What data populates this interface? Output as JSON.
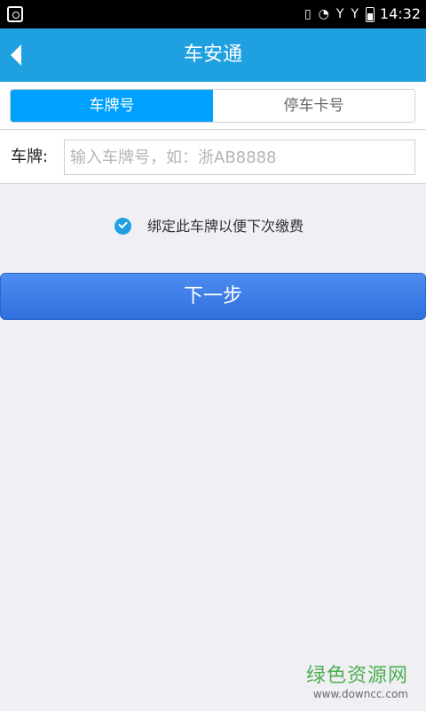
{
  "status_bar": {
    "time": "14:32",
    "indicator_1": "Y",
    "indicator_2": "Y"
  },
  "header": {
    "title": "车安通"
  },
  "tabs": [
    {
      "label": "车牌号",
      "active": true
    },
    {
      "label": "停车卡号",
      "active": false
    }
  ],
  "plate": {
    "label": "车牌:",
    "placeholder": "输入车牌号，如：浙AB8888",
    "value": ""
  },
  "bind": {
    "label": "绑定此车牌以便下次缴费",
    "checked": true
  },
  "next_button": {
    "label": "下一步"
  },
  "watermark": {
    "main": "绿色资源网",
    "sub": "www.downcc.com"
  },
  "colors": {
    "header_bg": "#1fa0e0",
    "active_tab_bg": "#00a0ff",
    "button_bg": "#3a7de8",
    "watermark": "#4caf50"
  }
}
